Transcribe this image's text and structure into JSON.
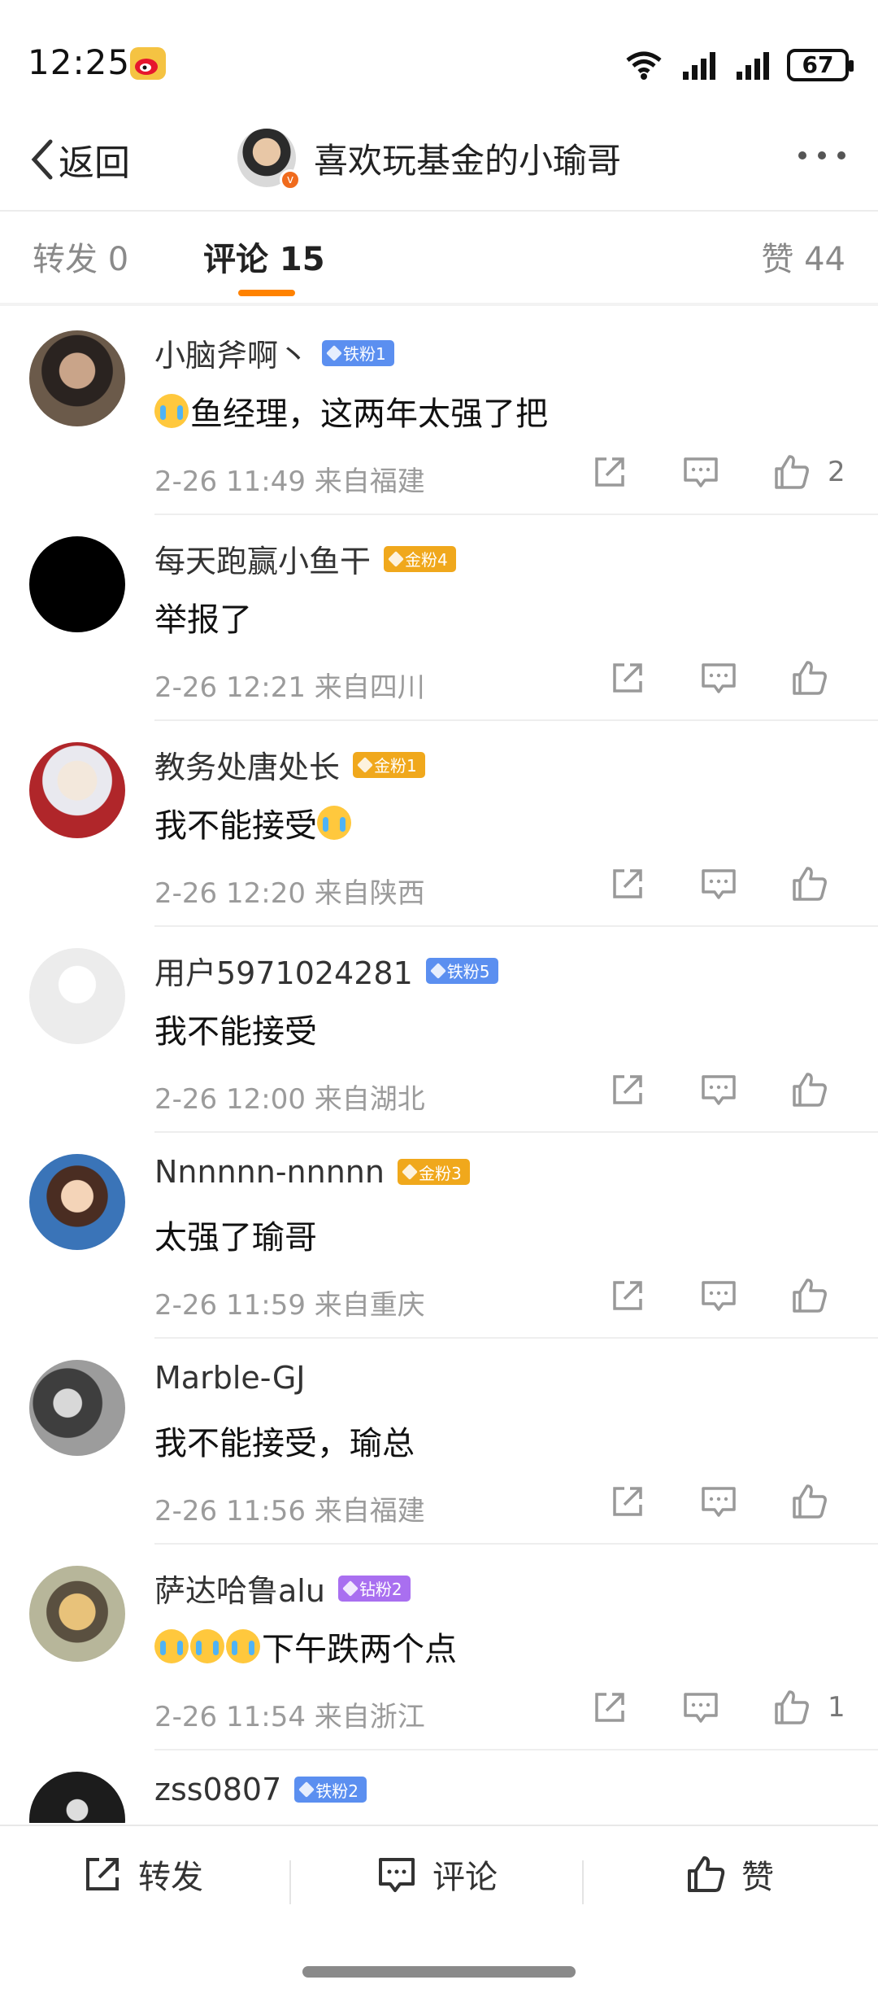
{
  "status_bar": {
    "time": "12:25",
    "signal1": "5A",
    "signal2": "5A",
    "wifi_label": "6",
    "battery": "67"
  },
  "nav": {
    "back_label": "返回",
    "title": "喜欢玩基金的小瑜哥"
  },
  "tabs": {
    "repost": "转发 0",
    "comments": "评论 15",
    "likes": "赞 44"
  },
  "comments": [
    {
      "name": "小脑斧啊丶",
      "badge": "铁粉1",
      "badge_type": "iron",
      "text": "鱼经理，这两年太强了把",
      "emoji_before": 1,
      "emoji_after": 0,
      "meta": "2-26 11:49 来自福建",
      "likes": "2"
    },
    {
      "name": "每天跑赢小鱼干",
      "badge": "金粉4",
      "badge_type": "gold",
      "text": "举报了",
      "emoji_before": 0,
      "emoji_after": 0,
      "meta": "2-26 12:21 来自四川",
      "likes": ""
    },
    {
      "name": "教务处唐处长",
      "badge": "金粉1",
      "badge_type": "gold",
      "text": "我不能接受",
      "emoji_before": 0,
      "emoji_after": 1,
      "meta": "2-26 12:20 来自陕西",
      "likes": ""
    },
    {
      "name": "用户5971024281",
      "badge": "铁粉5",
      "badge_type": "iron",
      "text": "我不能接受",
      "emoji_before": 0,
      "emoji_after": 0,
      "meta": "2-26 12:00 来自湖北",
      "likes": ""
    },
    {
      "name": "Nnnnnn-nnnnn",
      "badge": "金粉3",
      "badge_type": "gold",
      "text": "太强了瑜哥",
      "emoji_before": 0,
      "emoji_after": 0,
      "meta": "2-26 11:59 来自重庆",
      "likes": ""
    },
    {
      "name": "Marble-GJ",
      "badge": "",
      "badge_type": "",
      "text": "我不能接受，瑜总",
      "emoji_before": 0,
      "emoji_after": 0,
      "meta": "2-26 11:56 来自福建",
      "likes": ""
    },
    {
      "name": "萨达哈鲁alu",
      "badge": "钻粉2",
      "badge_type": "diamond",
      "text": "下午跌两个点",
      "emoji_before": 3,
      "emoji_after": 0,
      "meta": "2-26 11:54 来自浙江",
      "likes": "1"
    },
    {
      "name": "zss0807",
      "badge": "铁粉2",
      "badge_type": "iron",
      "text": "",
      "emoji_before": 0,
      "emoji_after": 0,
      "meta": "",
      "likes": ""
    }
  ],
  "bottom_bar": {
    "repost": "转发",
    "comment": "评论",
    "like": "赞"
  },
  "colors": {
    "accent": "#ff8200",
    "iron": "#5b8ff0",
    "gold": "#f0a81c",
    "diamond": "#a96ff0"
  }
}
